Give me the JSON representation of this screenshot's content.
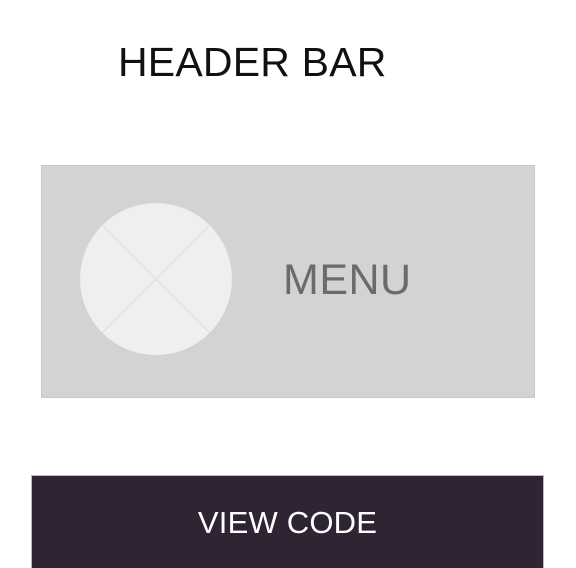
{
  "header": {
    "title": "HEADER BAR"
  },
  "menu": {
    "label": "MENU",
    "icon": "image-placeholder-icon"
  },
  "actions": {
    "view_code_label": "VIEW CODE"
  },
  "colors": {
    "page_background": "#ffffff",
    "menu_background": "#d2d3d5",
    "placeholder_fill": "#efefef",
    "button_background": "#2f2433",
    "button_text": "#ffffff",
    "menu_text": "#6b6b6d"
  }
}
